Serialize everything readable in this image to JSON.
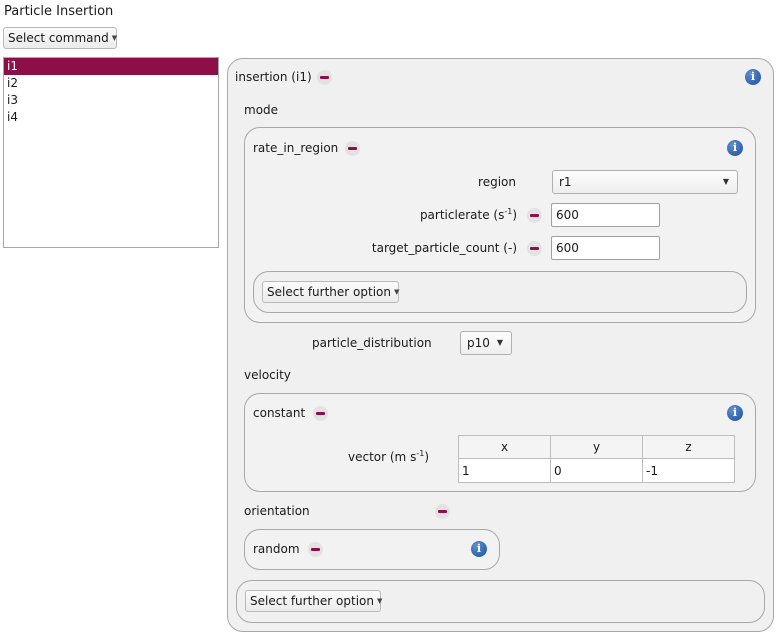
{
  "window": {
    "title": "Particle Insertion"
  },
  "toolbar": {
    "select_command_label": "Select command"
  },
  "insertion_list": [
    "i1",
    "i2",
    "i3",
    "i4"
  ],
  "insertion": {
    "header": "insertion (i1)",
    "mode": {
      "label": "mode",
      "rate_in_region": {
        "header": "rate_in_region",
        "region": {
          "label": "region",
          "value": "r1"
        },
        "particlerate": {
          "label_pre": "particlerate (s",
          "label_sup": "-1",
          "label_post": ")",
          "value": "600"
        },
        "target_particle_count": {
          "label": "target_particle_count (-)",
          "value": "600"
        },
        "further_option_label": "Select further option"
      }
    },
    "particle_distribution": {
      "label": "particle_distribution",
      "value": "p10"
    },
    "velocity": {
      "label": "velocity",
      "constant": {
        "header": "constant",
        "vector": {
          "label_pre": "vector (m s",
          "label_sup": "-1",
          "label_post": ")",
          "columns": [
            "x",
            "y",
            "z"
          ],
          "values": [
            "1",
            "0",
            "-1"
          ]
        }
      }
    },
    "orientation": {
      "label": "orientation",
      "random": {
        "header": "random"
      }
    },
    "further_option_label": "Select further option"
  },
  "icons": {
    "info": "info-icon",
    "remove": "minus-icon",
    "dropdown": "chevron-down-icon"
  },
  "colors": {
    "accent": "#8e0f48",
    "info": "#1b4f9c"
  }
}
